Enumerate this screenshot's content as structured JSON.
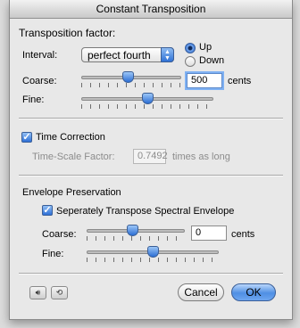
{
  "window": {
    "title": "Constant Transposition"
  },
  "transposition": {
    "heading": "Transposition factor:",
    "interval_label": "Interval:",
    "interval_value": "perfect fourth",
    "direction_up": "Up",
    "direction_down": "Down",
    "direction_selected": "Up",
    "coarse_label": "Coarse:",
    "coarse_value": "500",
    "coarse_unit": "cents",
    "coarse_slider_position": 0.46,
    "fine_label": "Fine:",
    "fine_slider_position": 0.5
  },
  "time_correction": {
    "checkbox_label": "Time Correction",
    "checked": true,
    "factor_label": "Time-Scale Factor:",
    "factor_value": "0.7492",
    "factor_suffix": "times as long"
  },
  "envelope": {
    "heading": "Envelope Preservation",
    "checkbox_label": "Seperately Transpose Spectral Envelope",
    "checked": true,
    "coarse_label": "Coarse:",
    "coarse_value": "0",
    "coarse_unit": "cents",
    "coarse_slider_position": 0.46,
    "fine_label": "Fine:",
    "fine_slider_position": 0.5
  },
  "footer": {
    "speaker_icon": "speaker-icon",
    "loop_icon": "loop-icon",
    "cancel_label": "Cancel",
    "ok_label": "OK"
  },
  "colors": {
    "accent": "#2f72d6",
    "window_bg": "#e8e8e8"
  }
}
